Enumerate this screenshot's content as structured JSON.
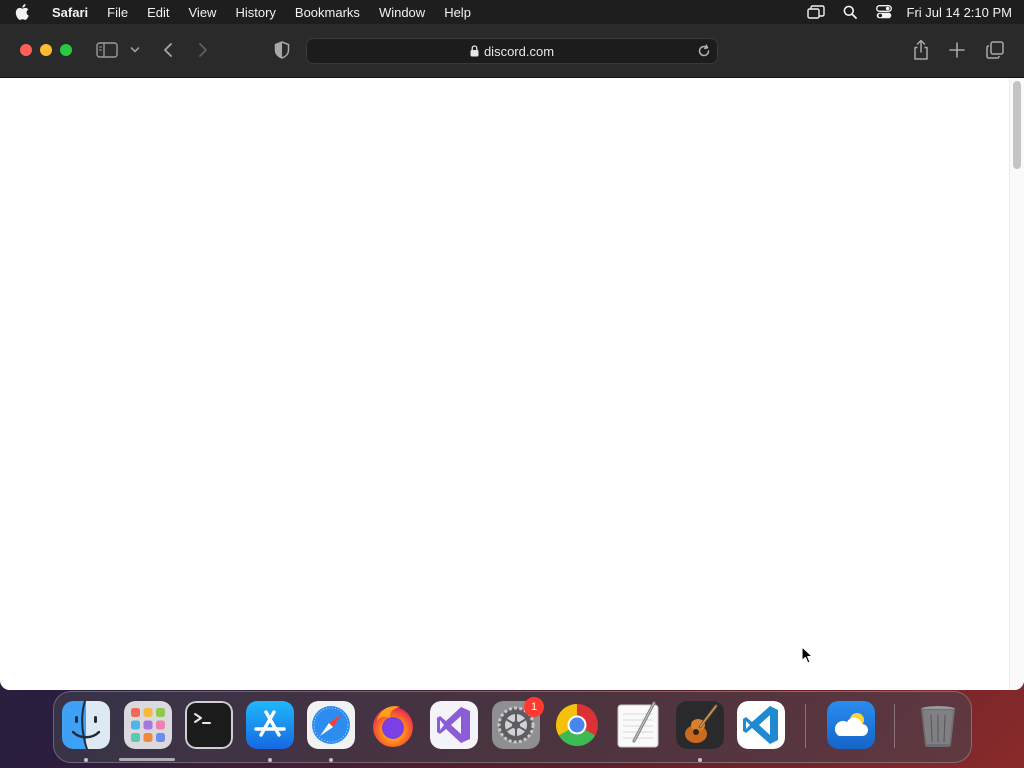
{
  "menubar": {
    "app_name": "Safari",
    "items": [
      "File",
      "Edit",
      "View",
      "History",
      "Bookmarks",
      "Window",
      "Help"
    ],
    "clock": "Fri Jul 14  2:10 PM",
    "status_icons": [
      "screen-mirroring-icon",
      "spotlight-search-icon",
      "control-center-icon"
    ]
  },
  "browser": {
    "url": "discord.com",
    "page_content": ""
  },
  "dock": {
    "apps": [
      {
        "name": "Finder",
        "icon": "finder-icon",
        "running": true
      },
      {
        "name": "Launchpad",
        "icon": "launchpad-icon",
        "running": false
      },
      {
        "name": "Terminal",
        "icon": "terminal-icon",
        "running": false
      },
      {
        "name": "App Store",
        "icon": "app-store-icon",
        "running": true
      },
      {
        "name": "Safari",
        "icon": "safari-icon",
        "running": true
      },
      {
        "name": "Firefox",
        "icon": "firefox-icon",
        "running": false
      },
      {
        "name": "Visual Studio",
        "icon": "visual-studio-icon",
        "running": false
      },
      {
        "name": "System Settings",
        "icon": "system-settings-icon",
        "running": false,
        "badge": "1"
      },
      {
        "name": "Google Chrome",
        "icon": "chrome-icon",
        "running": false
      },
      {
        "name": "TextEdit",
        "icon": "textedit-icon",
        "running": false
      },
      {
        "name": "GarageBand",
        "icon": "garageband-icon",
        "running": true
      },
      {
        "name": "Visual Studio Code",
        "icon": "vscode-icon",
        "running": false
      },
      {
        "name": "Weather",
        "icon": "weather-icon",
        "running": false
      },
      {
        "name": "Trash",
        "icon": "trash-icon",
        "running": false
      }
    ]
  },
  "colors": {
    "close": "#fe5f57",
    "minimize": "#febc2e",
    "maximize": "#28c840",
    "toolbar": "#2a2a2a",
    "menubar": "#1e1e1e",
    "badge": "#ff3b30"
  }
}
